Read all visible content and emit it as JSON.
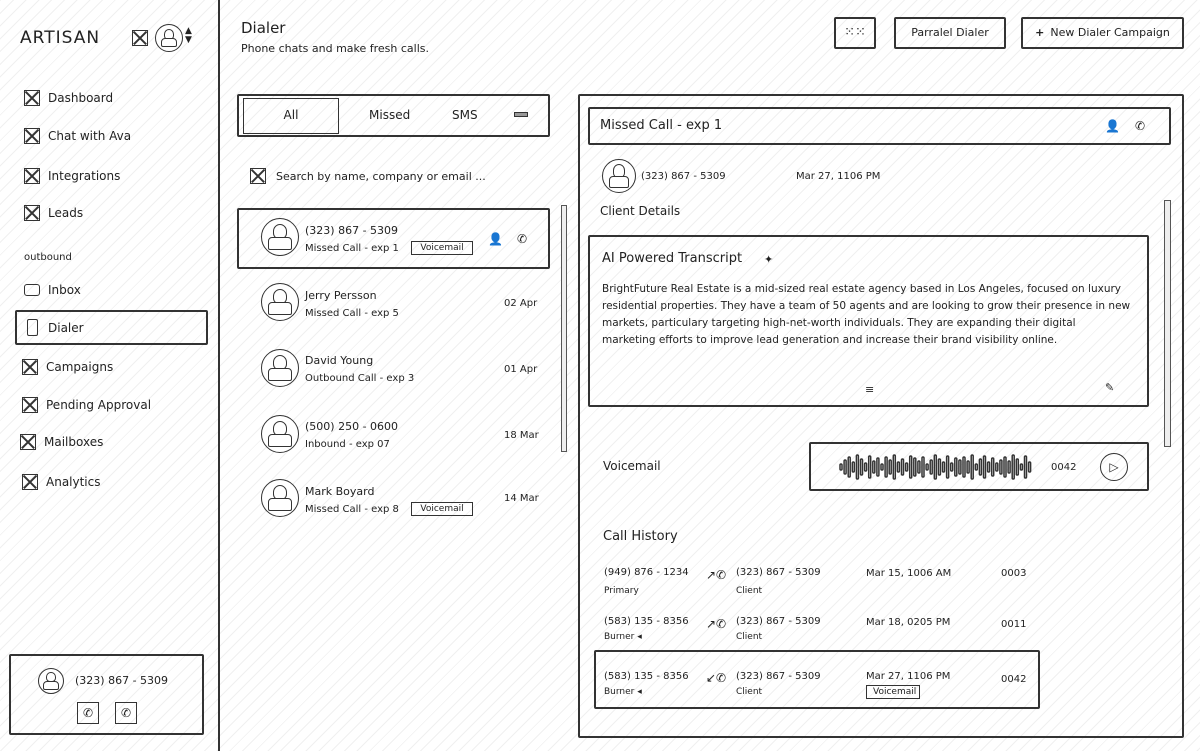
{
  "app": {
    "logo": "ARTISAN"
  },
  "sidebar": {
    "items": [
      {
        "label": "Dashboard",
        "icon": "x-placeholder-icon"
      },
      {
        "label": "Chat with Ava",
        "icon": "x-placeholder-icon"
      },
      {
        "label": "Integrations",
        "icon": "x-placeholder-icon"
      },
      {
        "label": "Leads",
        "icon": "x-placeholder-icon"
      }
    ],
    "section_label": "outbound",
    "outbound_items": [
      {
        "label": "Inbox",
        "icon": "inbox-icon"
      },
      {
        "label": "Dialer",
        "icon": "phone-device-icon",
        "active": true
      },
      {
        "label": "Campaigns",
        "icon": "x-placeholder-icon"
      },
      {
        "label": "Pending Approval",
        "icon": "x-placeholder-icon"
      },
      {
        "label": "Mailboxes",
        "icon": "x-placeholder-icon"
      },
      {
        "label": "Analytics",
        "icon": "x-placeholder-icon"
      }
    ],
    "footer": {
      "phone": "(323) 867 - 5309"
    }
  },
  "header": {
    "title": "Dialer",
    "subtitle": "Phone chats and make fresh calls.",
    "parallel_btn": "Parralel Dialer",
    "new_campaign_btn": "New Dialer Campaign",
    "new_campaign_icon": "+"
  },
  "tabs": [
    "All",
    "Missed",
    "SMS"
  ],
  "search": {
    "placeholder": "Search by name, company or email ..."
  },
  "calls": [
    {
      "name": "(323) 867 - 5309",
      "sub": "Missed Call - exp 1",
      "tag": "Voicemail",
      "date": "",
      "selected": true
    },
    {
      "name": "Jerry Persson",
      "sub": "Missed Call - exp 5",
      "tag": "",
      "date": "02 Apr"
    },
    {
      "name": "David Young",
      "sub": "Outbound Call - exp 3",
      "tag": "",
      "date": "01 Apr"
    },
    {
      "name": "(500) 250 - 0600",
      "sub": "Inbound - exp 07",
      "tag": "",
      "date": "18 Mar"
    },
    {
      "name": "Mark Boyard",
      "sub": "Missed Call - exp 8",
      "tag": "Voicemail",
      "date": "14 Mar"
    }
  ],
  "detail": {
    "title": "Missed Call - exp 1",
    "phone": "(323) 867 - 5309",
    "datetime": "Mar 27, 1106 PM",
    "client_details": "Client Details",
    "transcript_title": "AI Powered Transcript",
    "transcript": "BrightFuture Real Estate is a mid-sized real estate agency based in Los Angeles, focused on luxury residential properties. They have a team of 50 agents and are looking to grow their presence in new markets, particulary targeting high-net-worth individuals. They are expanding their digital marketing efforts to improve lead generation and increase their brand visibility online.",
    "voicemail_label": "Voicemail",
    "voicemail_duration": "0042",
    "call_history_title": "Call History",
    "history": [
      {
        "from": "(949) 876 - 1234",
        "from_sub": "Primary",
        "to": "(323) 867 - 5309",
        "to_sub": "Client",
        "date": "Mar 15, 1006 AM",
        "duration": "0003",
        "tag": "",
        "icon": "phone-outgoing-icon"
      },
      {
        "from": "(583) 135 - 8356",
        "from_sub": "Burner",
        "to": "(323) 867 - 5309",
        "to_sub": "Client",
        "date": "Mar 18, 0205 PM",
        "duration": "0011",
        "tag": "",
        "icon": "phone-outgoing-icon"
      },
      {
        "from": "(583) 135 - 8356",
        "from_sub": "Burner",
        "to": "(323) 867 - 5309",
        "to_sub": "Client",
        "date": "Mar 27, 1106 PM",
        "duration": "0042",
        "tag": "Voicemail",
        "icon": "phone-missed-icon",
        "selected": true
      }
    ]
  }
}
